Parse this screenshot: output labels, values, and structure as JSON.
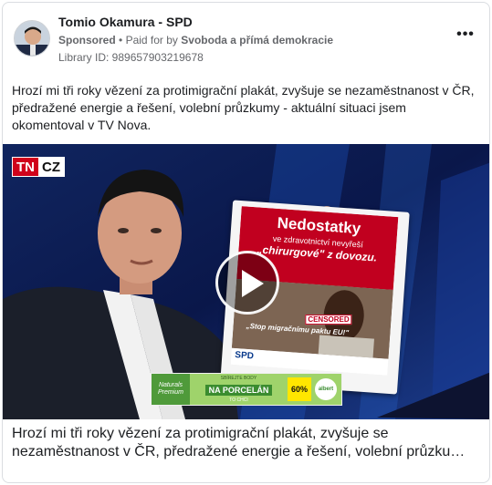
{
  "ad": {
    "page_name": "Tomio Okamura - SPD",
    "sponsored_label": "Sponsored",
    "separator": "•",
    "paid_for_prefix": "Paid for by",
    "payer": "Svoboda a přímá demokracie",
    "library_id": "Library ID: 989657903219678",
    "more_icon": "more-horizontal-icon"
  },
  "post": {
    "text": "Hrozí mi tři roky vězení za protimigrační plakát, zvyšuje se nezaměstnanost v ČR, předražené energie a řešení, volební průzkumy - aktuální situaci jsem okomentoval v TV Nova."
  },
  "video": {
    "channel_logo_left": "TN",
    "channel_logo_right": "CZ",
    "play_icon": "play-icon",
    "poster": {
      "headline": "Nedostatky",
      "line2": "ve zdravotnictví nevyřeší",
      "line3": "„chirurgové\" z dovozu.",
      "slogan": "„Stop migračnímu paktu EU!\"",
      "stamp": "CENSORED",
      "footer": "SPD"
    },
    "banner": {
      "brand": "Naturals Premium",
      "small_text": "SBÍREJTE BODY",
      "main_text": "NA PORCELÁN",
      "sub_text": "TO CHCI",
      "percent": "60%",
      "store": "albert"
    }
  },
  "caption": {
    "line1": "Hrozí mi tři roky vězení za protimigrační plakát, zvyšuje se",
    "line2": "nezaměstnanost v ČR, předražené energie a řešení, volební průzku…"
  },
  "colors": {
    "text_primary": "#1c1e21",
    "text_secondary": "#65676b",
    "border": "#dadde1",
    "studio_blue": "#0b1a4a",
    "tn_red": "#d0021b",
    "poster_red": "#c1001f"
  }
}
